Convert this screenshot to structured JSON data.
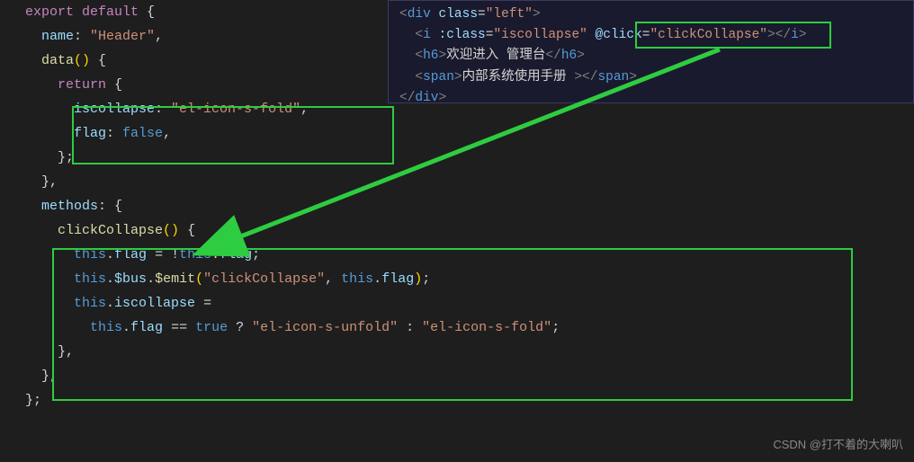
{
  "left": {
    "l1_export": "export",
    "l1_default": "default",
    "l1_ob": " {",
    "l2_name": "name",
    "l2_colon": ": ",
    "l2_val": "\"Header\"",
    "l2_comma": ",",
    "l3_data": "data",
    "l3_parens": "()",
    "l3_ob": " {",
    "l4_return": "return",
    "l4_ob": " {",
    "l5_iscollapse": "iscollapse",
    "l5_colon": ": ",
    "l5_val": "\"el-icon-s-fold\"",
    "l5_comma": ",",
    "l6_flag": "flag",
    "l6_colon": ": ",
    "l6_false": "false",
    "l6_comma": ",",
    "l7_cb": "};",
    "l8_cb": "},",
    "l9_methods": "methods",
    "l9_colon": ": ",
    "l9_ob": "{",
    "l10_clickCollapse": "clickCollapse",
    "l10_parens": "()",
    "l10_ob": " {",
    "l11_this": "this",
    "l11_dot": ".",
    "l11_flag": "flag",
    "l11_eq": " = !",
    "l11_this2": "this",
    "l11_flag2": "flag",
    "l11_semi": ";",
    "l12_this": "this",
    "l12_bus": "$bus",
    "l12_emit": "$emit",
    "l12_op": "(",
    "l12_str": "\"clickCollapse\"",
    "l12_comma": ", ",
    "l12_this2": "this",
    "l12_flag": "flag",
    "l12_cp": ")",
    "l12_semi": ";",
    "l13_this": "this",
    "l13_iscollapse": "iscollapse",
    "l13_eq": " =",
    "l14_this": "this",
    "l14_flag": "flag",
    "l14_eqeq": " == ",
    "l14_true": "true",
    "l14_q": " ? ",
    "l14_str1": "\"el-icon-s-unfold\"",
    "l14_colon": " : ",
    "l14_str2": "\"el-icon-s-fold\"",
    "l14_semi": ";",
    "l15_cb": "},",
    "l16_cb": "},",
    "l17_cb": "};"
  },
  "right": {
    "r1_open": "<",
    "r1_div": "div",
    "r1_class": " class",
    "r1_eq": "=",
    "r1_val": "\"left\"",
    "r1_close": ">",
    "r2_open": "<",
    "r2_i": "i",
    "r2_cls": " :class",
    "r2_eq": "=",
    "r2_val1": "\"iscollapse\"",
    "r2_click": " @click",
    "r2_val2": "\"clickCollapse\"",
    "r2_close": ">",
    "r2_ec_open": "</",
    "r2_ec_i": "i",
    "r2_ec_close": ">",
    "r3_open": "<",
    "r3_h6": "h6",
    "r3_close": ">",
    "r3_text": "欢迎进入 管理台",
    "r3_ec_open": "</",
    "r3_ec_h6": "h6",
    "r3_ec_close": ">",
    "r4_open": "<",
    "r4_span": "span",
    "r4_close": ">",
    "r4_text": "内部系统使用手册 ",
    "r4_ec_open": "></",
    "r4_ec_span": "span",
    "r4_ec_close": ">",
    "r5_open": "</",
    "r5_div": "div",
    "r5_close": ">"
  },
  "watermark": "CSDN @打不着的大喇叭"
}
